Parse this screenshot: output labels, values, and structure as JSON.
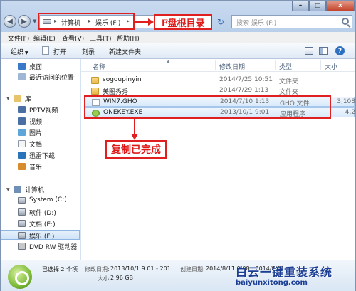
{
  "address": {
    "segments": [
      "计算机",
      "娱乐 (F:)"
    ],
    "separator": "▸",
    "refresh_icon": "refresh-icon"
  },
  "search": {
    "placeholder": "搜索 娱乐 (F:)"
  },
  "window_controls": {
    "minimize": "–",
    "maximize": "□",
    "close": "x"
  },
  "menu": [
    "文件(F)",
    "编辑(E)",
    "查看(V)",
    "工具(T)",
    "帮助(H)"
  ],
  "toolbar": {
    "organize": "组织",
    "open": "打开",
    "burn": "刻录",
    "new_folder": "新建文件夹",
    "help": "?"
  },
  "nav": {
    "desktop": "桌面",
    "recent": "最近访问的位置",
    "library": "库",
    "pptv": "PPTV视频",
    "video": "视频",
    "pictures": "图片",
    "documents": "文档",
    "thunder": "迅雷下载",
    "music": "音乐",
    "computer": "计算机",
    "drive_c": "System (C:)",
    "drive_d": "软件 (D:)",
    "drive_e": "文档 (E:)",
    "drive_f": "娱乐 (F:)",
    "dvd": "DVD RW 驱动器"
  },
  "columns": {
    "name": "名称",
    "date": "修改日期",
    "type": "类型",
    "size": "大小"
  },
  "files": [
    {
      "name": "sogoupinyin",
      "date": "2014/7/25 10:51",
      "type": "文件夹",
      "size": ""
    },
    {
      "name": "美图秀秀",
      "date": "2014/7/29 1:13",
      "type": "文件夹",
      "size": ""
    },
    {
      "name": "WIN7.GHO",
      "date": "2014/7/10 1:13",
      "type": "GHO 文件",
      "size": "3,108"
    },
    {
      "name": "ONEKEY.EXE",
      "date": "2013/10/1 9:01",
      "type": "应用程序",
      "size": "4,2"
    }
  ],
  "annotations": {
    "f_root": "F盘根目录",
    "copy_done": "复制已完成"
  },
  "details": {
    "selected": "已选择 2 个项",
    "modified_label": "修改日期:",
    "modified_value": "2013/10/1 9:01 - 201...",
    "created_label": "创建日期:",
    "created_value": "2014/8/11 9:08 - 2014/8/11...",
    "size_label": "大小:",
    "size_value": "2.96 GB"
  },
  "watermark": {
    "title": "白云一键重装系统",
    "url": "baiyunxitong.com"
  },
  "colors": {
    "annotation_red": "#e02020",
    "watermark_blue": "#1c3f95"
  }
}
